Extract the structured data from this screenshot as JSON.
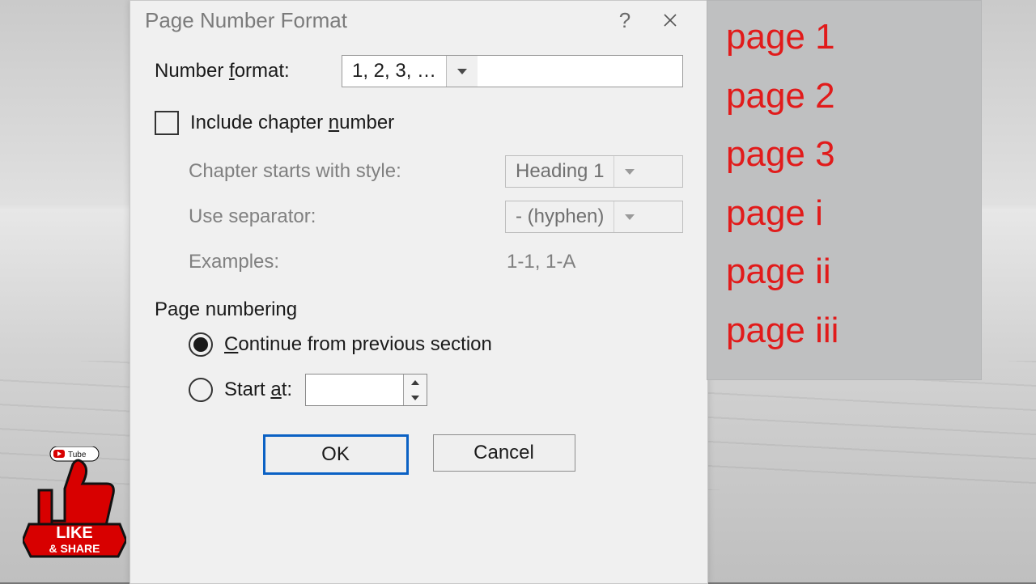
{
  "dialog": {
    "title": "Page Number Format",
    "number_format_label_pre": "Number ",
    "number_format_label_u": "f",
    "number_format_label_post": "ormat:",
    "number_format_value": "1, 2, 3, …",
    "include_chapter_pre": "Include chapter ",
    "include_chapter_u": "n",
    "include_chapter_post": "umber",
    "chapter_style_label": "Chapter starts with style:",
    "chapter_style_value": "Heading 1",
    "separator_label": "Use separator:",
    "separator_value": "-   (hyphen)",
    "examples_label": "Examples:",
    "examples_value": "1-1, 1-A",
    "page_numbering_label": "Page numbering",
    "continue_u": "C",
    "continue_post": "ontinue from previous section",
    "start_pre": "Start ",
    "start_u": "a",
    "start_post": "t:",
    "start_value": "",
    "ok": "OK",
    "cancel": "Cancel"
  },
  "side_list": [
    "page 1",
    "page 2",
    "page 3",
    "page i",
    "page ii",
    "page iii"
  ],
  "badge": {
    "youtube": "YouTube",
    "like": "LIKE",
    "share": "& SHARE"
  }
}
